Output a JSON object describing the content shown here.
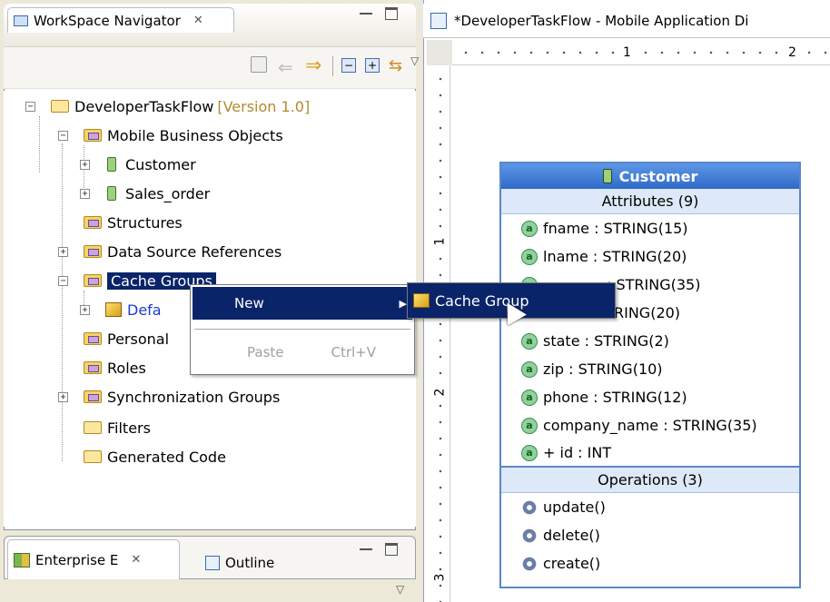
{
  "navigator": {
    "title": "WorkSpace Navigator",
    "close_glyph": "✕",
    "tree": {
      "root": {
        "label": "DeveloperTaskFlow",
        "version": "[Version 1.0]"
      },
      "items": [
        {
          "label": "Mobile Business Objects"
        },
        {
          "label": "Customer"
        },
        {
          "label": "Sales_order"
        },
        {
          "label": "Structures"
        },
        {
          "label": "Data Source References"
        },
        {
          "label": "Cache Groups"
        },
        {
          "label": "Defa"
        },
        {
          "label": "Personal"
        },
        {
          "label": "Roles"
        },
        {
          "label": "Synchronization Groups"
        },
        {
          "label": "Filters"
        },
        {
          "label": "Generated Code"
        }
      ]
    }
  },
  "bottom_tabs": {
    "enterprise": "Enterprise E",
    "outline": "Outline",
    "close_glyph": "✕"
  },
  "context_menu": {
    "new_label": "New",
    "paste_label": "Paste",
    "paste_shortcut": "Ctrl+V",
    "submenu_item": "Cache Group"
  },
  "editor": {
    "tab_title": "*DeveloperTaskFlow - Mobile Application Di",
    "ruler_labels": [
      "1",
      "2"
    ],
    "vruler_labels": [
      "1",
      "2",
      "3"
    ]
  },
  "mbo": {
    "name": "Customer",
    "attributes_header": "Attributes (9)",
    "attributes": [
      "fname : STRING(15)",
      "lname : STRING(20)",
      "address : STRING(35)",
      "city : STRING(20)",
      "state : STRING(2)",
      "zip : STRING(10)",
      "phone : STRING(12)",
      "company_name : STRING(35)",
      "+ id : INT"
    ],
    "attributes_visible": [
      "fname : STRING(15)",
      "lname : STRING(20)",
      "a",
      ": STRING(35)",
      "RING(20)",
      "state : STRING(2)",
      "zip : STRING(10)",
      "phone : STRING(12)",
      "company_name : STRING(35)",
      "+ id : INT"
    ],
    "operations_header": "Operations (3)",
    "operations": [
      "update()",
      "delete()",
      "create()"
    ]
  }
}
